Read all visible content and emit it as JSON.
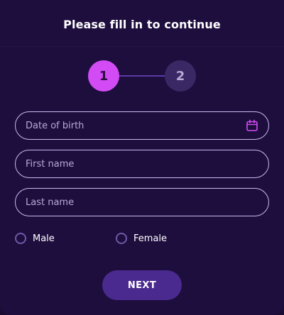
{
  "modal": {
    "title": "Please fill in to continue"
  },
  "stepper": {
    "steps": [
      {
        "label": "1",
        "active": true
      },
      {
        "label": "2",
        "active": false
      }
    ]
  },
  "form": {
    "date_of_birth": {
      "placeholder": "Date of birth",
      "value": ""
    },
    "first_name": {
      "placeholder": "First name",
      "value": ""
    },
    "last_name": {
      "placeholder": "Last name",
      "value": ""
    },
    "gender_options": [
      {
        "label": "Male",
        "checked": false
      },
      {
        "label": "Female",
        "checked": false
      }
    ]
  },
  "actions": {
    "next_label": "NEXT"
  },
  "icons": {
    "date_field_icon": "calendar-icon"
  },
  "colors": {
    "accent": "#d34bf5",
    "button": "#4a2a8f",
    "background": "#1e0e3e"
  }
}
